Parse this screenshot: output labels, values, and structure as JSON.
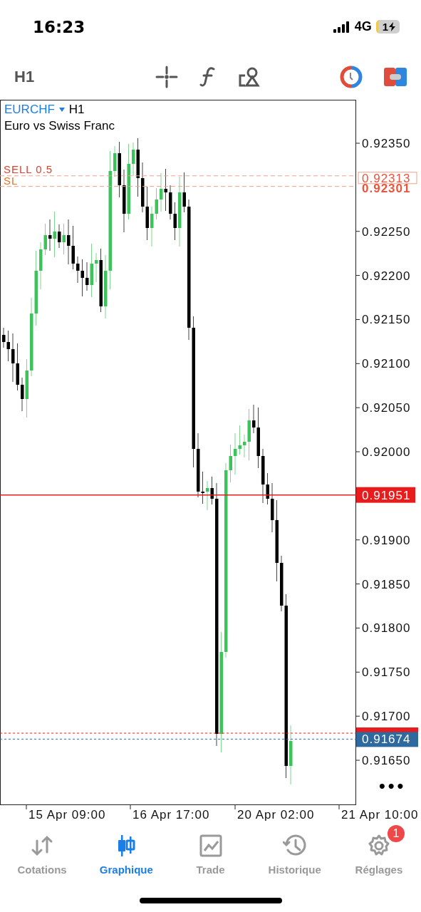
{
  "status_bar": {
    "time": "16:23",
    "network": "4G",
    "battery": "1"
  },
  "toolbar": {
    "timeframe": "H1"
  },
  "chart": {
    "symbol": "EURCHF",
    "timeframe": "H1",
    "description": "Euro vs Swiss Franc",
    "y_labels": [
      "0.92350",
      "0.92250",
      "0.92200",
      "0.92150",
      "0.92100",
      "0.92050",
      "0.92000",
      "0.91900",
      "0.91850",
      "0.91800",
      "0.91750",
      "0.91700",
      "0.91650"
    ],
    "levels": [
      {
        "kind": "order",
        "label": "SELL 0.5",
        "price": "0.92313"
      },
      {
        "kind": "sl",
        "label": "SL",
        "price": "0.92301"
      },
      {
        "kind": "bid",
        "price": "0.91951"
      },
      {
        "kind": "covered"
      },
      {
        "kind": "ask",
        "price": "0.91674"
      }
    ],
    "time_labels": [
      "15 Apr 09:00",
      "16 Apr 17:00",
      "20 Apr 02:00",
      "21 Apr 10:00"
    ],
    "more": "•••"
  },
  "tabs": [
    {
      "kind": "quotes",
      "label": "Cotations",
      "selected": false
    },
    {
      "kind": "chart",
      "label": "Graphique",
      "selected": true
    },
    {
      "kind": "trade",
      "label": "Trade",
      "selected": false
    },
    {
      "kind": "history",
      "label": "Historique",
      "selected": false
    },
    {
      "kind": "settings",
      "label": "Réglages",
      "selected": false,
      "badge": "1"
    }
  ]
}
